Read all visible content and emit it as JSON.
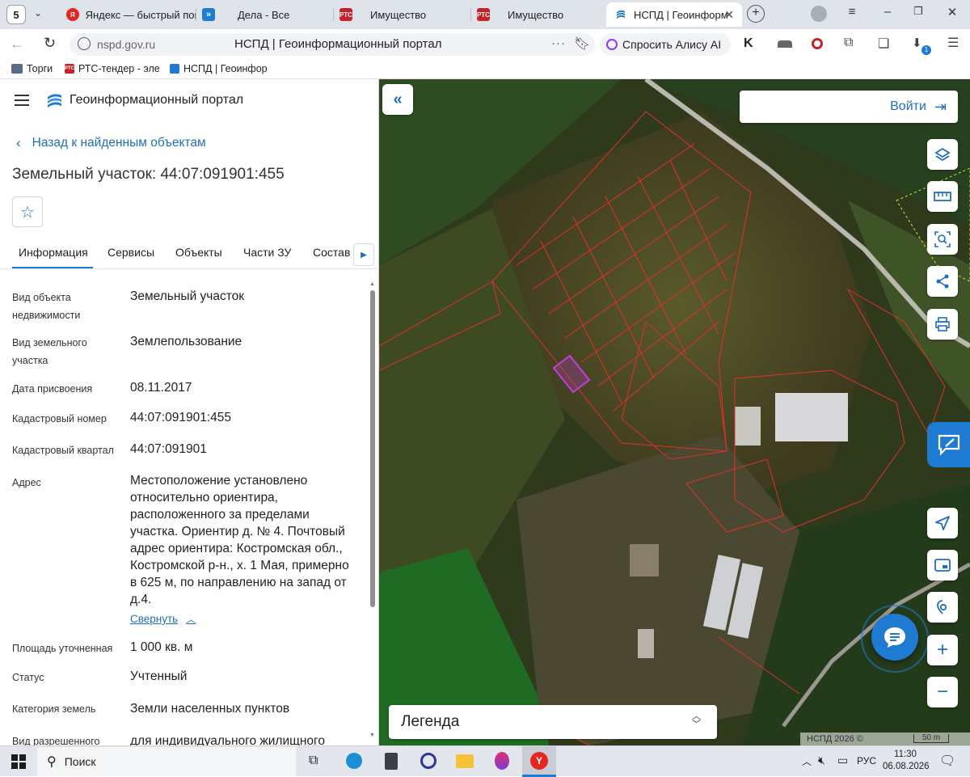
{
  "browser": {
    "tab_counter": "5",
    "tabs": [
      {
        "label": "Яндекс — быстрый пои",
        "icon": "yandex-icon"
      },
      {
        "label": "Дела - Все",
        "icon": "tasks-icon"
      },
      {
        "label": "Имущество",
        "icon": "rts-icon"
      },
      {
        "label": "Имущество",
        "icon": "rts-icon"
      },
      {
        "label": "НСПД | Геоинформ",
        "icon": "nspd-icon",
        "active": true
      }
    ],
    "url": "nspd.gov.ru",
    "page_title": "НСПД | Геоинформационный портал",
    "alice_label": "Спросить Алису AI",
    "extension_badge": "1",
    "bookmarks": [
      {
        "label": "Торги"
      },
      {
        "label": "РТС-тендер - эле"
      },
      {
        "label": "НСПД | Геоинфор"
      }
    ],
    "fav_text": {
      "rts": "РТС",
      "yandex": "Я"
    }
  },
  "portal": {
    "title": "Геоинформационный портал",
    "back_link": "Назад к найденным объектам",
    "object_title": "Земельный участок: 44:07:091901:455",
    "tabs": [
      "Информация",
      "Сервисы",
      "Объекты",
      "Части ЗУ",
      "Состав"
    ],
    "active_tab": 0,
    "properties": [
      {
        "label": "Вид объекта недвижимости",
        "value": "Земельный участок"
      },
      {
        "label": "Вид земельного участка",
        "value": "Землепользование"
      },
      {
        "label": "Дата присвоения",
        "value": "08.11.2017"
      },
      {
        "label": "Кадастровый номер",
        "value": "44:07:091901:455"
      },
      {
        "label": "Кадастровый квартал",
        "value": "44:07:091901"
      },
      {
        "label": "Адрес",
        "value": "Местоположение установлено относительно ориентира, расположенного за пределами участка. Ориентир д. № 4. Почтовый адрес ориентира: Костромская обл., Костромской р-н., х. 1 Мая, примерно в 625 м, по направлению на запад от д.4."
      },
      {
        "label": "Площадь уточненная",
        "value": "1 000 кв. м"
      },
      {
        "label": "Статус",
        "value": "Учтенный"
      },
      {
        "label": "Категория земель",
        "value": "Земли населенных пунктов"
      },
      {
        "label": "Вид разрешенного",
        "value": "для индивидуального жилищного"
      }
    ],
    "collapse_link": "Свернуть"
  },
  "map": {
    "login_label": "Войти",
    "legend_label": "Легенда",
    "copyright": "НСПД 2026 ©",
    "scale": "50 m",
    "accent": "#1f7ad1",
    "parcel_color": "#e0302a",
    "selected_color": "#c63ce0"
  },
  "taskbar": {
    "search_label": "Поиск",
    "lang": "РУС",
    "time": "11:30",
    "date": "06.08.2026"
  }
}
